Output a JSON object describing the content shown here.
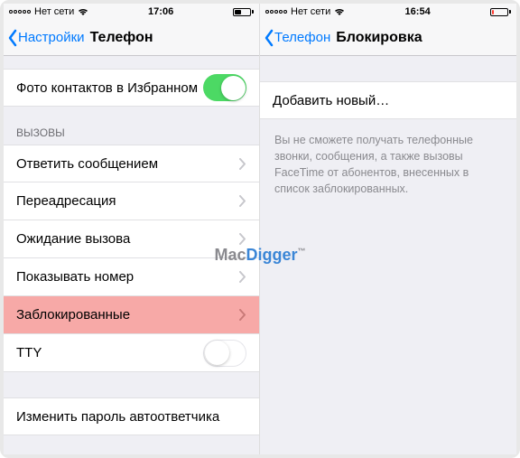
{
  "left": {
    "status": {
      "carrier": "Нет сети",
      "time": "17:06"
    },
    "nav": {
      "back": "Настройки",
      "title": "Телефон"
    },
    "row_photo": "Фото контактов в Избранном",
    "calls_header": "ВЫЗОВЫ",
    "rows": {
      "reply_msg": "Ответить сообщением",
      "forwarding": "Переадресация",
      "waiting": "Ожидание вызова",
      "show_number": "Показывать номер",
      "blocked": "Заблокированные",
      "tty": "TTY",
      "change_pwd": "Изменить пароль автоответчика"
    }
  },
  "right": {
    "status": {
      "carrier": "Нет сети",
      "time": "16:54"
    },
    "nav": {
      "back": "Телефон",
      "title": "Блокировка"
    },
    "add_new": "Добавить новый…",
    "footer": "Вы не сможете получать телефонные звонки, сообщения, а также вызовы FaceTime от абонентов, внесенных в список заблокированных."
  },
  "watermark": {
    "part1": "Mac",
    "part2": "Digger",
    "tm": "™"
  }
}
